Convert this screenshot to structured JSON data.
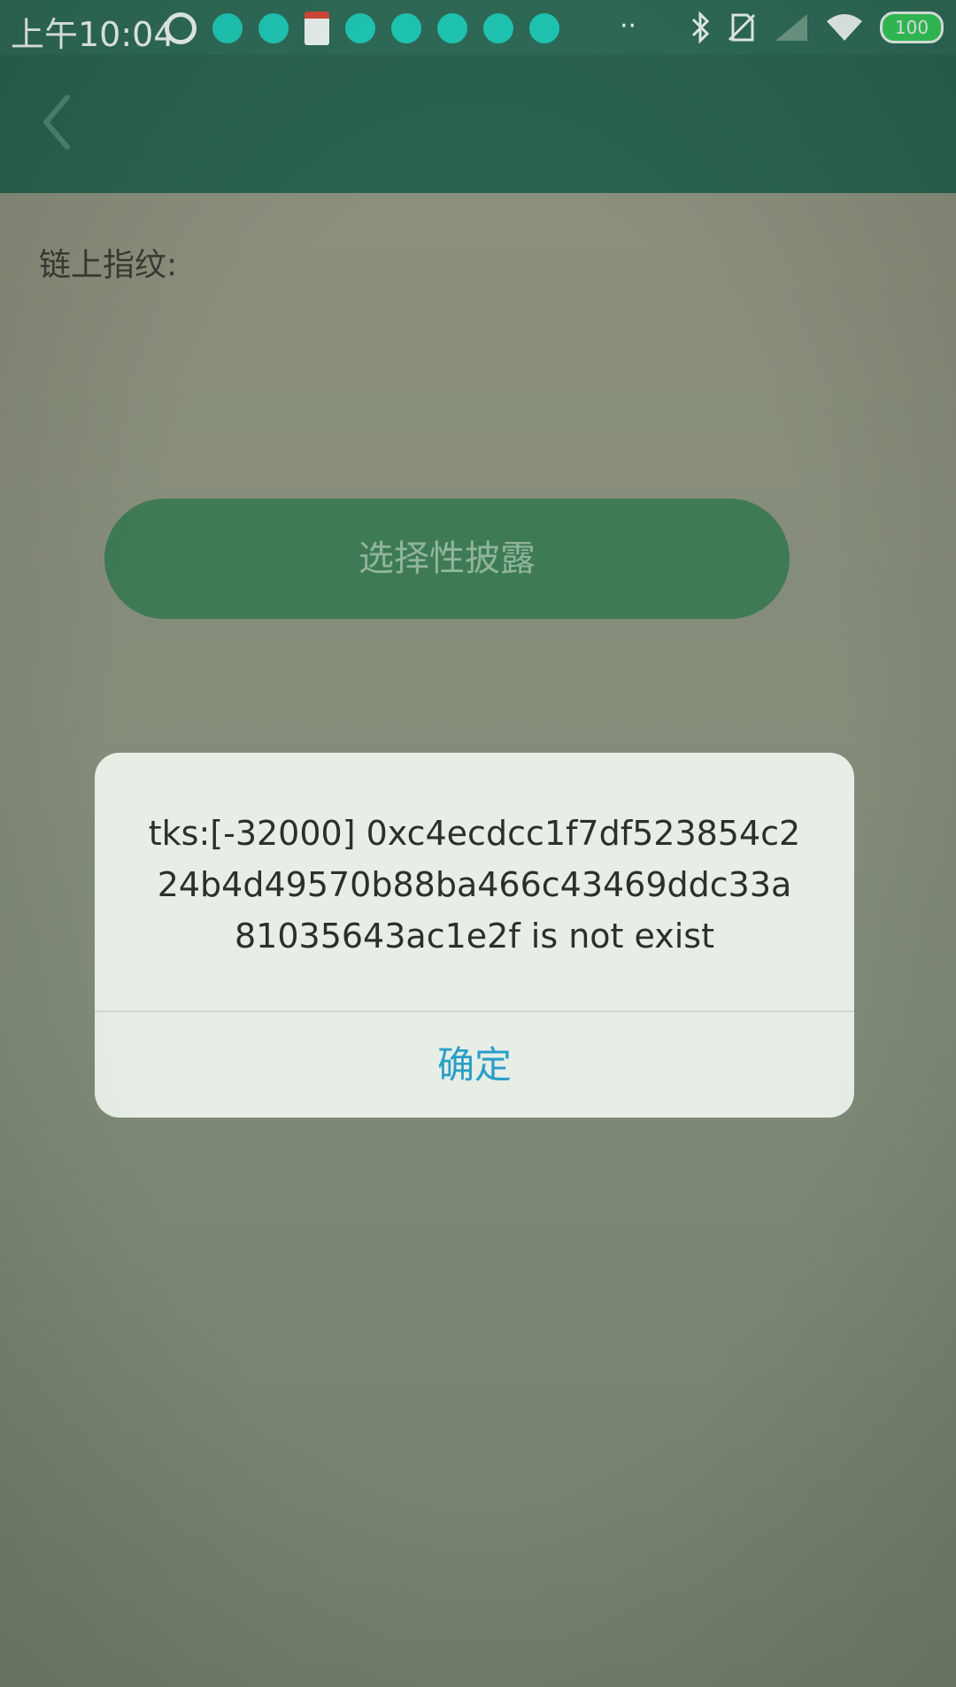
{
  "status_bar": {
    "time": "上午10:04",
    "more": "··",
    "battery": "100",
    "left_icons": [
      "record-icon",
      "notification-dot",
      "notification-dot",
      "calendar-icon",
      "notification-dot",
      "notification-dot",
      "notification-dot",
      "notification-dot",
      "notification-dot"
    ],
    "right_icons": [
      "bluetooth-icon",
      "no-sim-icon",
      "signal-icon",
      "wifi-icon",
      "battery-icon"
    ]
  },
  "toolbar": {
    "back_icon": "chevron-left-icon"
  },
  "content": {
    "fingerprint_label": "链上指纹:",
    "primary_button_label": "选择性披露"
  },
  "dialog": {
    "message": "tks:[-32000] 0xc4ecdcc1f7df523854c224b4d49570b88ba466c43469ddc33a81035643ac1e2f is not exist",
    "confirm_label": "确定"
  },
  "colors": {
    "toolbar": "#2b6350",
    "button": "#3f7a56",
    "dialog_bg": "#e6eee6",
    "confirm_text": "#2a9ec7"
  }
}
